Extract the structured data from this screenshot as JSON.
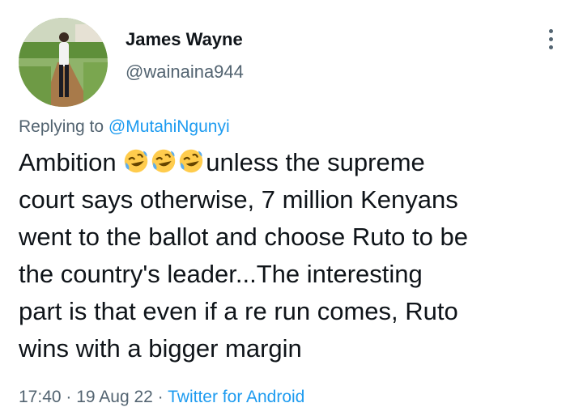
{
  "author": {
    "display_name": "James Wayne",
    "handle": "@wainaina944"
  },
  "reply": {
    "prefix": "Replying to ",
    "mention": "@MutahiNgunyi"
  },
  "tweet": {
    "line1_start": "Ambition ",
    "emoji_name": "rolling-on-the-floor-laughing",
    "emoji_count": 3,
    "line1_end": "unless the supreme",
    "line2": "court says otherwise, 7 million Kenyans",
    "line3": "went to the ballot and choose Ruto to be",
    "line4": "the country's leader...The interesting",
    "line5": "part is that even if a re run comes, Ruto",
    "line6": "wins with a bigger margin"
  },
  "meta": {
    "time": "17:40",
    "separator": " · ",
    "date": "19 Aug 22",
    "source": "Twitter for Android"
  },
  "colors": {
    "text": "#0f1419",
    "secondary": "#536471",
    "link": "#1d9bf0",
    "emoji_face": "#ffcc4d"
  },
  "icons": {
    "more": "more-vertical-icon",
    "avatar": "avatar-photo"
  }
}
